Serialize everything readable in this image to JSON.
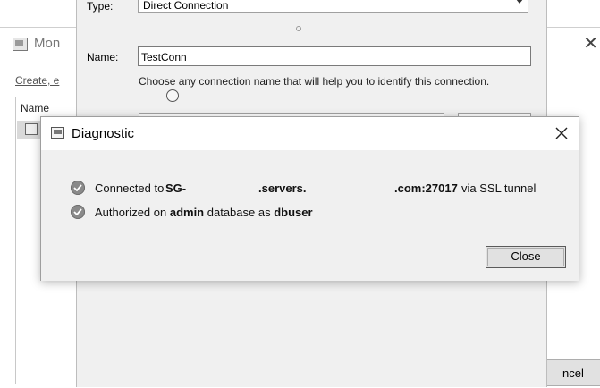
{
  "background_window": {
    "title": "Mon",
    "close_glyph": "✕",
    "link_text": "Create, e",
    "list_header": "Name",
    "cancel_label": "ncel"
  },
  "connection_dialog": {
    "type_label": "Type:",
    "type_value": "Direct Connection",
    "name_label": "Name:",
    "name_value": "TestConn",
    "name_hint": "Choose any connection name that will help you to identify this connection."
  },
  "diagnostic": {
    "title": "Diagnostic",
    "line1": {
      "prefix": "Connected to ",
      "host_a": "SG-",
      "host_b": ".servers.",
      "host_c": ".com:27017",
      "suffix": " via SSL tunnel"
    },
    "line2": {
      "prefix": "Authorized on ",
      "database": "admin",
      "middle": " database as ",
      "user": "dbuser"
    },
    "close_button": "Close",
    "status_icon": "check-circle-icon"
  }
}
